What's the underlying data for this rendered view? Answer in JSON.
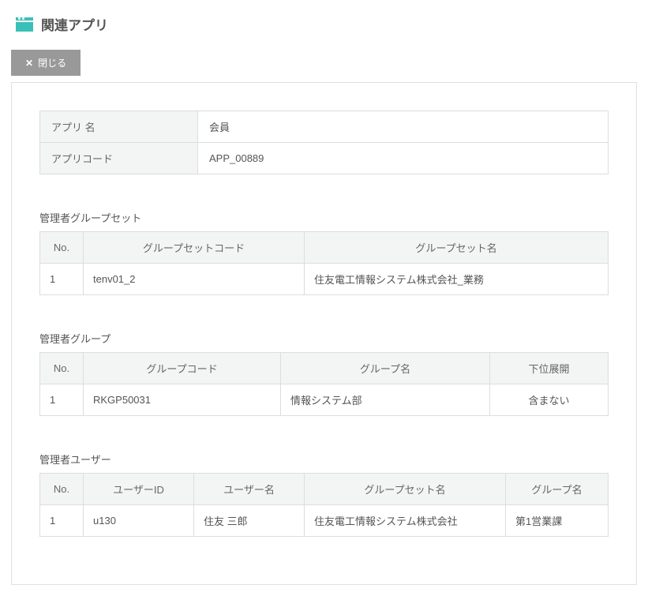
{
  "header": {
    "title": "関連アプリ"
  },
  "toolbar": {
    "close_label": "閉じる"
  },
  "info": {
    "app_name_label": "アプリ 名",
    "app_name_value": "会員",
    "app_code_label": "アプリコード",
    "app_code_value": "APP_00889"
  },
  "groupset_section": {
    "title": "管理者グループセット",
    "headers": {
      "no": "No.",
      "code": "グループセットコード",
      "name": "グループセット名"
    },
    "rows": [
      {
        "no": "1",
        "code": "tenv01_2",
        "name": "住友電工情報システム株式会社_業務"
      }
    ]
  },
  "group_section": {
    "title": "管理者グループ",
    "headers": {
      "no": "No.",
      "code": "グループコード",
      "name": "グループ名",
      "expand": "下位展開"
    },
    "rows": [
      {
        "no": "1",
        "code": "RKGP50031",
        "name": "情報システム部",
        "expand": "含まない"
      }
    ]
  },
  "user_section": {
    "title": "管理者ユーザー",
    "headers": {
      "no": "No.",
      "userid": "ユーザーID",
      "username": "ユーザー名",
      "groupset": "グループセット名",
      "group": "グループ名"
    },
    "rows": [
      {
        "no": "1",
        "userid": "u130",
        "username": "住友 三郎",
        "groupset": "住友電工情報システム株式会社",
        "group": "第1営業課"
      }
    ]
  }
}
